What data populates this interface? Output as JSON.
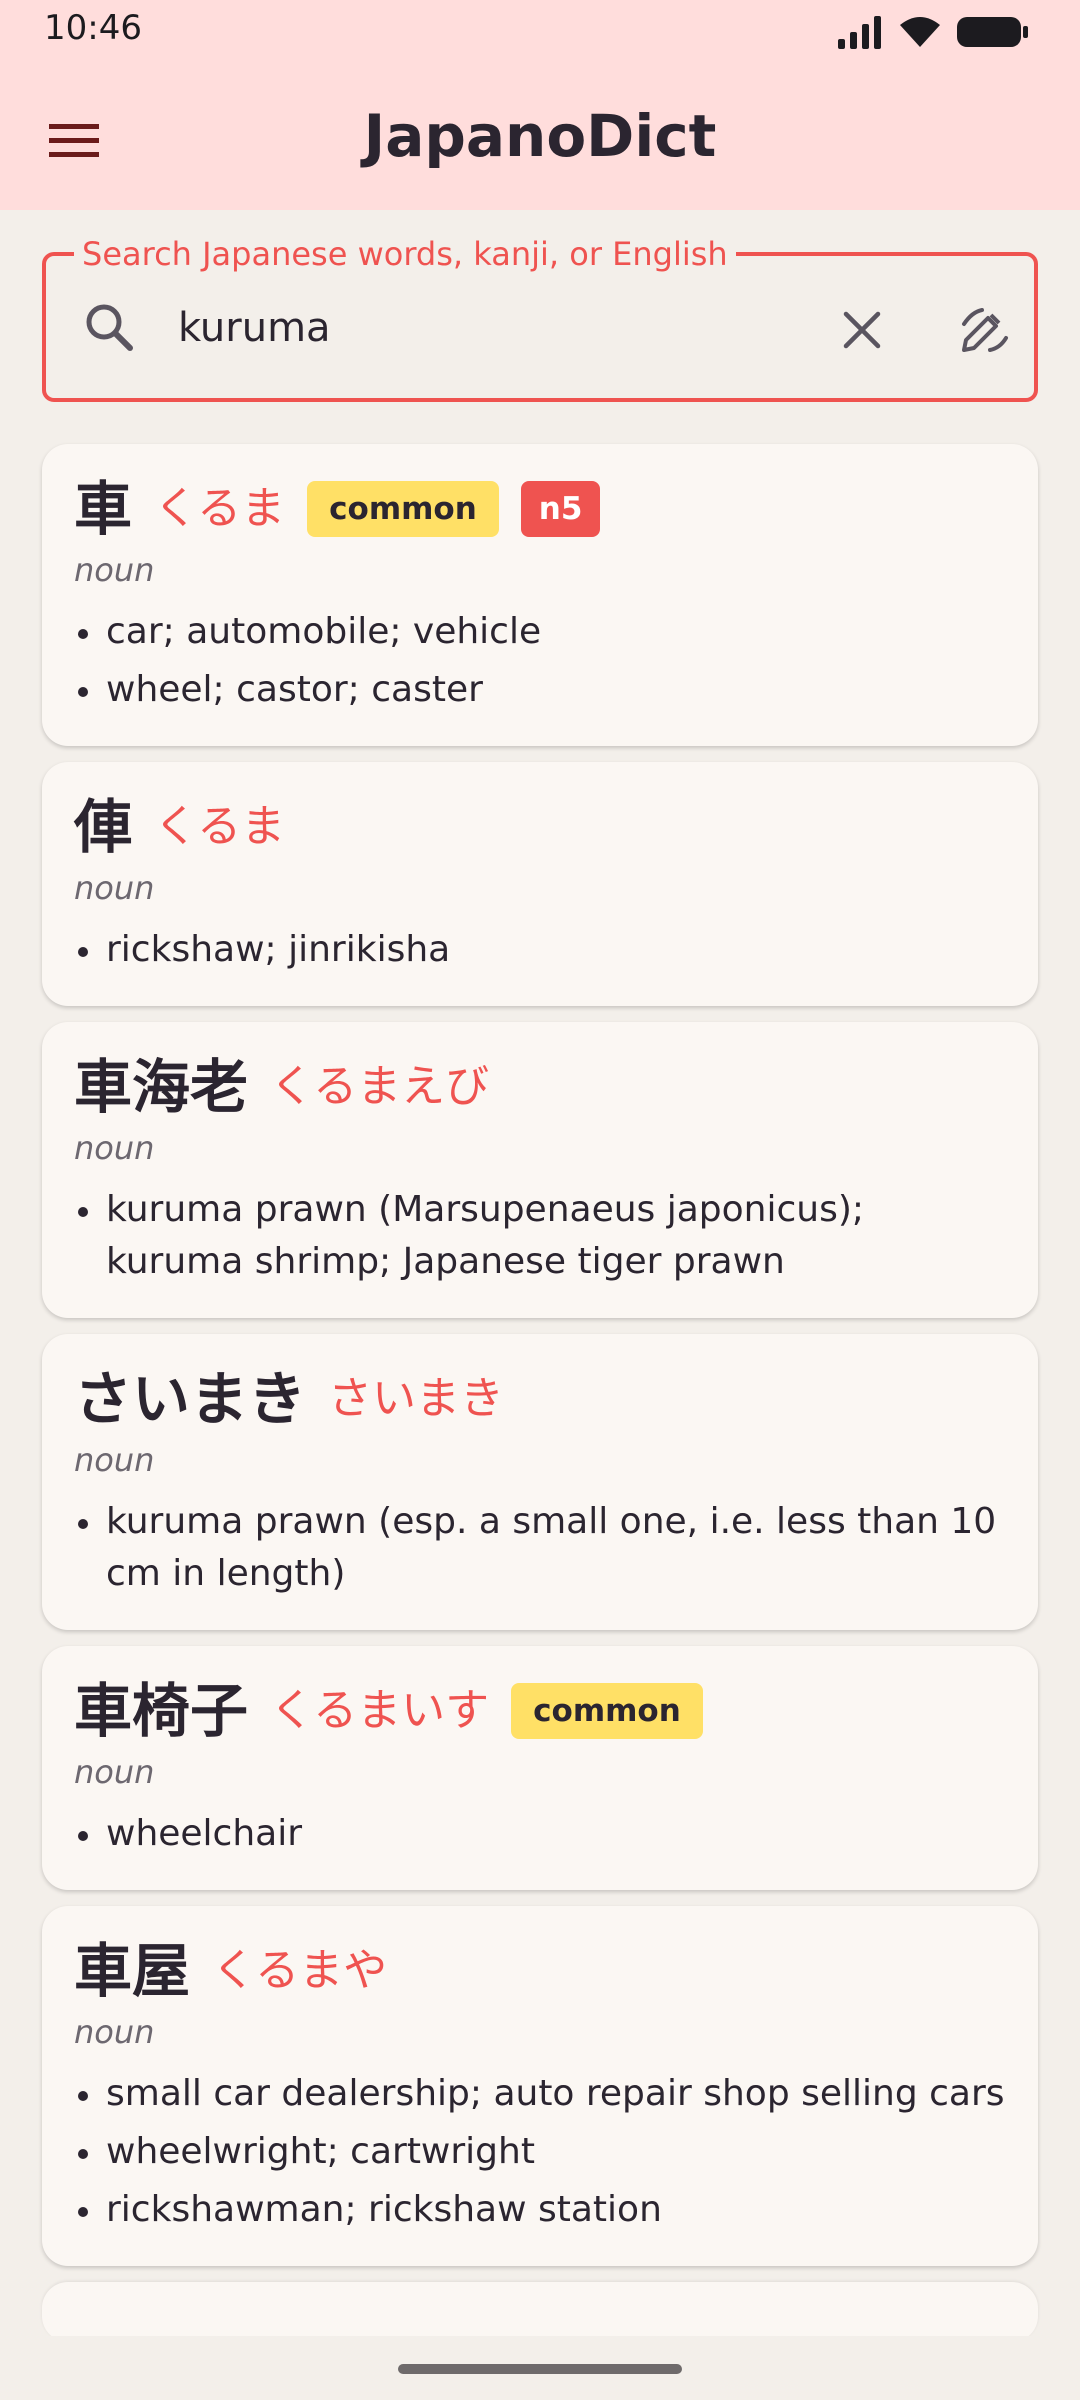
{
  "status_bar": {
    "time": "10:46"
  },
  "app_bar": {
    "title": "JapanoDict",
    "menu_icon": "hamburger-menu-icon"
  },
  "search": {
    "label": "Search Japanese words, kanji, or English",
    "value": "kuruma",
    "search_icon": "search-icon",
    "clear_icon": "close-icon",
    "handwriting_icon": "draw-icon"
  },
  "colors": {
    "accent": "#EF5350",
    "header_bg": "#FFDDDC",
    "common_badge": "#FFE066",
    "card_bg": "#FBF7F3",
    "page_bg": "#F3EFEA"
  },
  "results": [
    {
      "word": "車",
      "reading": "くるま",
      "badges": [
        "common",
        "n5"
      ],
      "pos": "noun",
      "senses": [
        "car; automobile; vehicle",
        "wheel; castor; caster"
      ]
    },
    {
      "word": "俥",
      "reading": "くるま",
      "badges": [],
      "pos": "noun",
      "senses": [
        "rickshaw; jinrikisha"
      ]
    },
    {
      "word": "車海老",
      "reading": "くるまえび",
      "badges": [],
      "pos": "noun",
      "senses": [
        "kuruma prawn (Marsupenaeus japonicus); kuruma shrimp; Japanese tiger prawn"
      ]
    },
    {
      "word": "さいまき",
      "reading": "さいまき",
      "badges": [],
      "pos": "noun",
      "senses": [
        "kuruma prawn (esp. a small one, i.e. less than 10 cm in length)"
      ]
    },
    {
      "word": "車椅子",
      "reading": "くるまいす",
      "badges": [
        "common"
      ],
      "pos": "noun",
      "senses": [
        "wheelchair"
      ]
    },
    {
      "word": "車屋",
      "reading": "くるまや",
      "badges": [],
      "pos": "noun",
      "senses": [
        "small car dealership; auto repair shop selling cars",
        "wheelwright; cartwright",
        "rickshawman; rickshaw station"
      ]
    }
  ]
}
